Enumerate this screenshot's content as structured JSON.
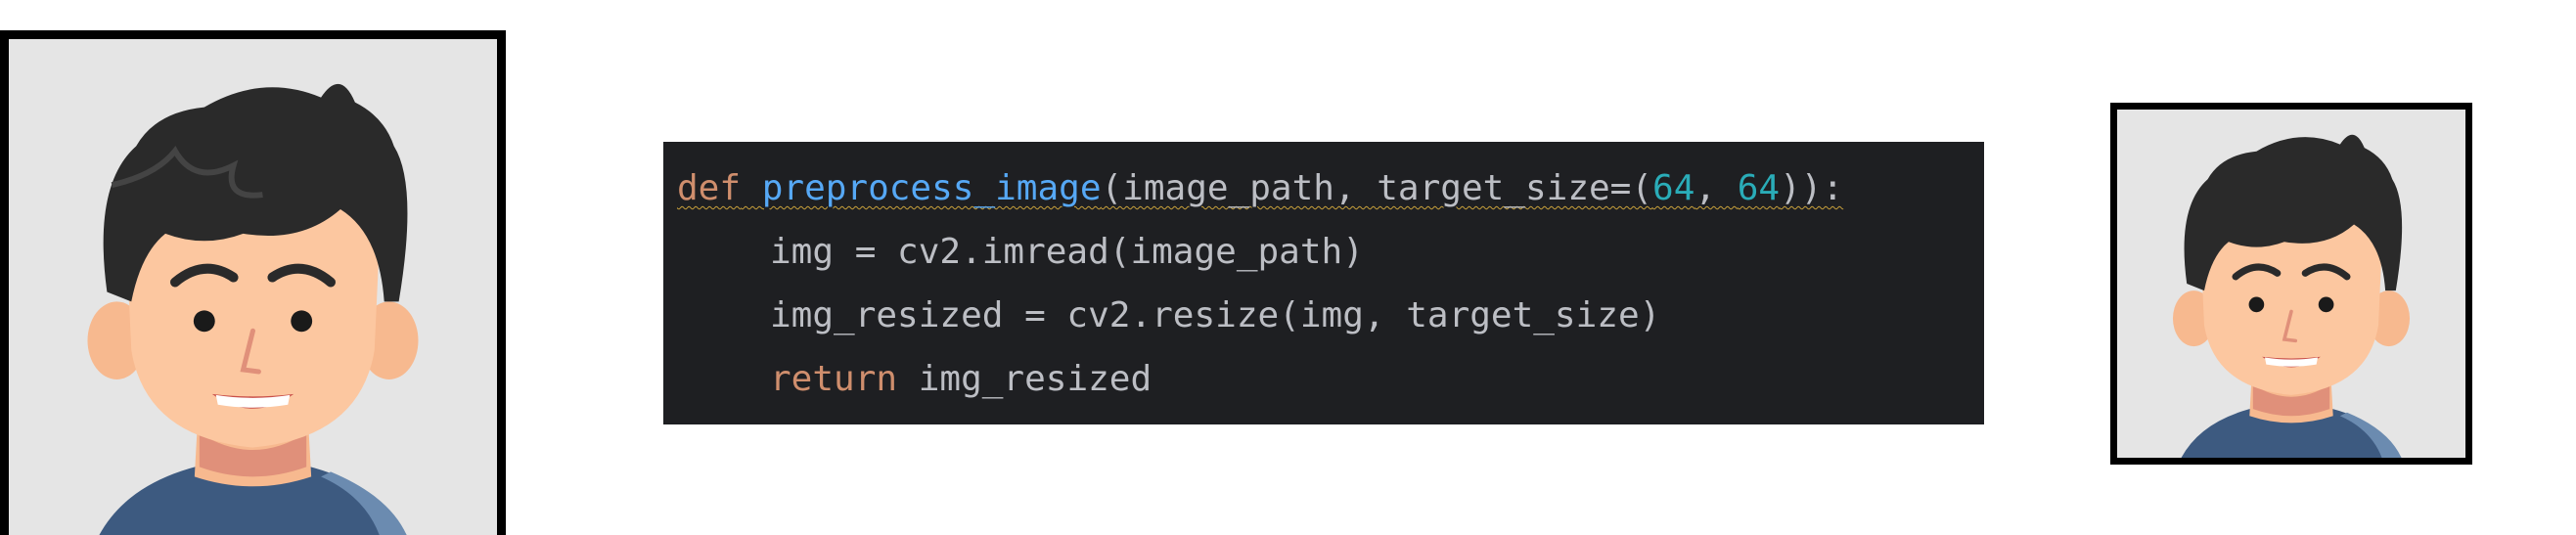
{
  "illustrations": {
    "input_image": {
      "icon": "avatar-portrait-icon",
      "background": "#e5e5e5",
      "border": "#000000"
    },
    "output_image": {
      "icon": "avatar-portrait-icon",
      "background": "#e5e5e5",
      "border": "#000000"
    }
  },
  "code": {
    "line1": {
      "kw": "def",
      "fn": "preprocess_image",
      "p1": "(image_path, target_size=(",
      "n1": "64",
      "sep": ", ",
      "n2": "64",
      "end": ")):"
    },
    "line2": {
      "text": "img = cv2.imread(image_path)"
    },
    "line3": {
      "text": "img_resized = cv2.resize(img, target_size)"
    },
    "line4": {
      "kw": "return",
      "rest": " img_resized"
    }
  },
  "colors": {
    "code_background": "#1e1f22",
    "keyword": "#cf8e6d",
    "function": "#56a8f5",
    "number": "#2aacb8",
    "default_text": "#bcbec4"
  }
}
